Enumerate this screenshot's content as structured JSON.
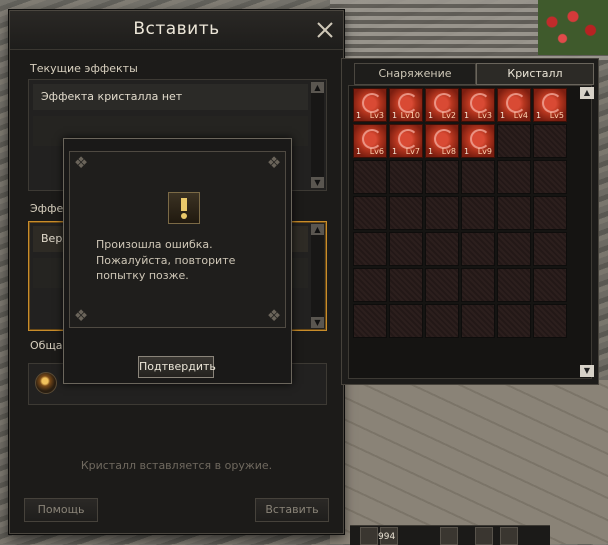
{
  "window": {
    "title": "Вставить",
    "current_effects_label": "Текущие эффекты",
    "current_effects_value": "Эффекта кристалла нет",
    "effects_after_label": "Эффек",
    "effects_after_value": "Верх.",
    "total_label": "Общая",
    "hint": "Кристалл вставляется в оружие.",
    "help_button": "Помощь",
    "insert_button": "Вставить"
  },
  "inventory": {
    "tabs": [
      "Снаряжение",
      "Кристалл"
    ],
    "active_tab": "Кристалл",
    "crystals": [
      {
        "count": "1",
        "level": "Lv3"
      },
      {
        "count": "1",
        "level": "Lv10"
      },
      {
        "count": "1",
        "level": "Lv2"
      },
      {
        "count": "1",
        "level": "Lv3"
      },
      {
        "count": "1",
        "level": "Lv4"
      },
      {
        "count": "1",
        "level": "Lv5"
      },
      {
        "count": "1",
        "level": "Lv6"
      },
      {
        "count": "1",
        "level": "Lv7"
      },
      {
        "count": "1",
        "level": "Lv8"
      },
      {
        "count": "1",
        "level": "Lv9"
      }
    ],
    "rows": 7,
    "cols": 6
  },
  "popup": {
    "icon": "exclamation-icon",
    "line1": "Произошла ошибка.",
    "line2": "Пожалуйста, повторите попытку позже.",
    "confirm": "Подтвердить"
  },
  "hotbar": {
    "number": "994"
  },
  "colors": {
    "accent": "#c98d2a",
    "crystal": "#b6361f"
  }
}
